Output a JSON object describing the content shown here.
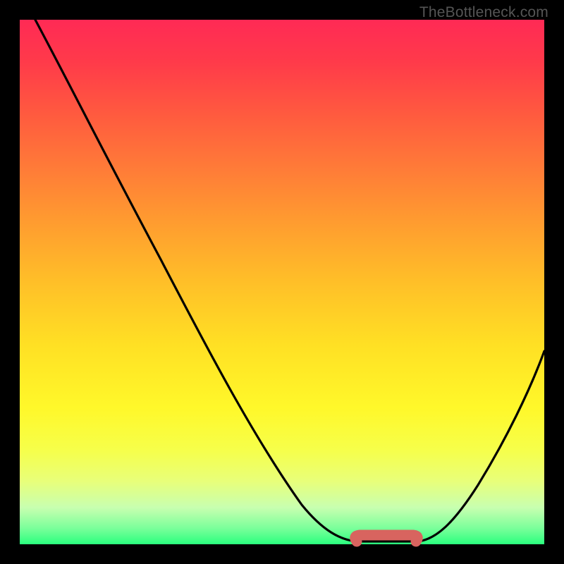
{
  "watermark": "TheBottleneck.com",
  "chart_data": {
    "type": "line",
    "title": "",
    "xlabel": "",
    "ylabel": "",
    "xlim": [
      0,
      100
    ],
    "ylim": [
      0,
      100
    ],
    "series": [
      {
        "name": "bottleneck-curve",
        "x": [
          3,
          10,
          20,
          30,
          40,
          50,
          56,
          60,
          64,
          68,
          72,
          76,
          82,
          88,
          94,
          100
        ],
        "y": [
          100,
          89,
          73,
          57,
          41,
          25,
          14,
          6,
          1,
          0,
          0,
          1,
          7,
          18,
          32,
          48
        ]
      }
    ],
    "highlight": {
      "name": "optimal-range",
      "x_range": [
        64,
        76
      ],
      "y": 0,
      "color": "#d8645f"
    },
    "background_gradient": {
      "top": "#ff2a55",
      "mid": "#ffe024",
      "bottom": "#2aff7e"
    }
  }
}
